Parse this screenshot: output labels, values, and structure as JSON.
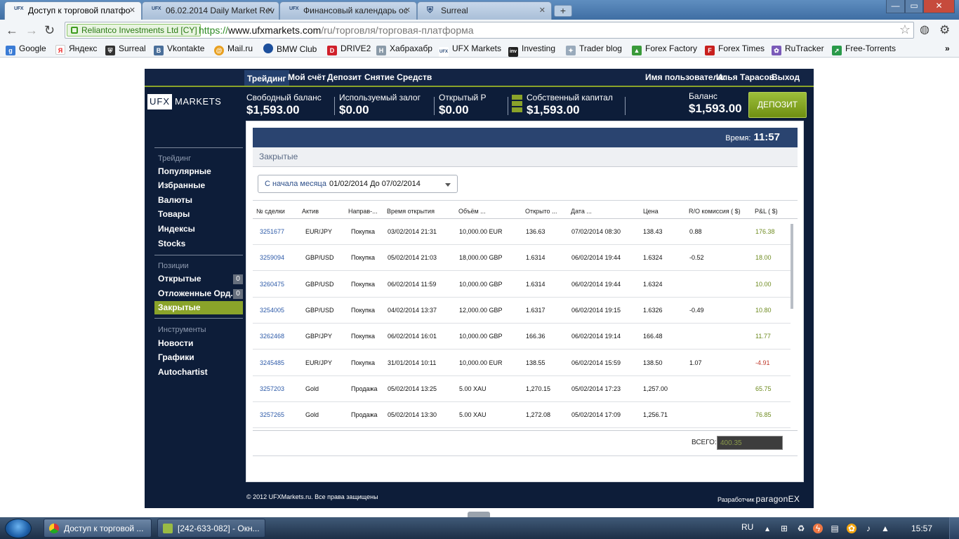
{
  "browser": {
    "tabs": [
      {
        "fav": "UFX",
        "title": "Доступ к торговой платфо"
      },
      {
        "fav": "UFX",
        "title": "06.02.2014 Daily Market Rev"
      },
      {
        "fav": "UFX",
        "title": "Финансовый календарь ос"
      },
      {
        "fav": "shield-icon",
        "title": "Surreal"
      }
    ],
    "new_tab": "+",
    "window_controls": {
      "minimize": "—",
      "maximize": "▭",
      "close": "✕"
    },
    "ev_cert": "Reliantco Investments Ltd [CY]",
    "url": {
      "scheme": "https://",
      "host": "www.ufxmarkets.com",
      "path": "/ru/торговля/торговая-платформа"
    },
    "bookmarks": [
      "Google",
      "Яндекс",
      "Surreal",
      "Vkontakte",
      "Mail.ru",
      "BMW Club",
      "DRIVE2",
      "Хабрахабр",
      "UFX Markets",
      "Investing",
      "Trader blog",
      "Forex Factory",
      "Forex Times",
      "RuTracker",
      "Free-Torrents"
    ],
    "bookmarks_more": "»"
  },
  "site": {
    "nav": {
      "trading": "Трейдинг",
      "account": "Мой счёт",
      "deposit": "Депозит",
      "withdraw": "Снятие Средств"
    },
    "user": {
      "label": "Имя пользователя:",
      "name": "Илья Тарасов",
      "logout": "Выход"
    },
    "logo": {
      "box": "UFX",
      "text": "MARKETS"
    },
    "stats": {
      "free_balance": {
        "label": "Свободный баланс",
        "value": "$1,593.00"
      },
      "used_margin": {
        "label": "Используемый залог",
        "value": "$0.00"
      },
      "open_pl": {
        "label": "Открытый P",
        "value": "$0.00"
      },
      "equity": {
        "label": "Собственный капитал",
        "value": "$1,593.00"
      },
      "balance": {
        "label": "Баланс",
        "value": "$1,593.00"
      }
    },
    "deposit_button": "ДЕПОЗИТ",
    "sidebar": {
      "trading_header": "Трейдинг",
      "trading_items": [
        "Популярные",
        "Избранные",
        "Валюты",
        "Товары",
        "Индексы",
        "Stocks"
      ],
      "positions_header": "Позиции",
      "open": "Открытые",
      "open_count": "0",
      "pending": "Отложенные Орд...",
      "pending_count": "0",
      "closed": "Закрытые",
      "tools_header": "Инструменты",
      "tools_items": [
        "Новости",
        "Графики",
        "Autochartist"
      ]
    },
    "panel": {
      "time_label": "Время:",
      "time_value": "11:57",
      "section": "Закрытые",
      "range_label": "С начала месяца",
      "range_value": "01/02/2014 До 07/02/2014",
      "columns": [
        "№ сделки",
        "Актив",
        "Направ-...",
        "Время открытия",
        "Объём ...",
        "Открыто ...",
        "Дата ...",
        "Цена",
        "R/O комиссия ( $)",
        "P&L ( $)"
      ],
      "rows": [
        [
          "3251677",
          "EUR/JPY",
          "Покупка",
          "03/02/2014 21:31",
          "10,000.00 EUR",
          "136.63",
          "07/02/2014 08:30",
          "138.43",
          "0.88",
          "176.38"
        ],
        [
          "3259094",
          "GBP/USD",
          "Покупка",
          "05/02/2014 21:03",
          "18,000.00 GBP",
          "1.6314",
          "06/02/2014 19:44",
          "1.6324",
          "-0.52",
          "18.00"
        ],
        [
          "3260475",
          "GBP/USD",
          "Покупка",
          "06/02/2014 11:59",
          "10,000.00 GBP",
          "1.6314",
          "06/02/2014 19:44",
          "1.6324",
          "",
          "10.00"
        ],
        [
          "3254005",
          "GBP/USD",
          "Покупка",
          "04/02/2014 13:37",
          "12,000.00 GBP",
          "1.6317",
          "06/02/2014 19:15",
          "1.6326",
          "-0.49",
          "10.80"
        ],
        [
          "3262468",
          "GBP/JPY",
          "Покупка",
          "06/02/2014 16:01",
          "10,000.00 GBP",
          "166.36",
          "06/02/2014 19:14",
          "166.48",
          "",
          "11.77"
        ],
        [
          "3245485",
          "EUR/JPY",
          "Покупка",
          "31/01/2014 10:11",
          "10,000.00 EUR",
          "138.55",
          "06/02/2014 15:59",
          "138.50",
          "1.07",
          "-4.91"
        ],
        [
          "3257203",
          "Gold",
          "Продажа",
          "05/02/2014 13:25",
          "5.00 XAU",
          "1,270.15",
          "05/02/2014 17:23",
          "1,257.00",
          "",
          "65.75"
        ],
        [
          "3257265",
          "Gold",
          "Продажа",
          "05/02/2014 13:30",
          "5.00 XAU",
          "1,272.08",
          "05/02/2014 17:09",
          "1,256.71",
          "",
          "76.85"
        ]
      ],
      "total_label": "ВСЕГО:",
      "total_value": "400.35"
    },
    "footer": {
      "copyright": "© 2012 UFXMarkets.ru. Все права защищены",
      "dev_label": "Разработчик",
      "dev_name": "paragonEX"
    }
  },
  "taskbar": {
    "items": [
      "Доступ к торговой ...",
      "[242-633-082] - Окн..."
    ],
    "lang": "RU",
    "clock": "15:57"
  },
  "colors": {
    "site_bg": "#0d1d39",
    "accent_green": "#8aa32a",
    "header_blue": "#2a4470",
    "pl_positive": "#6d8a1e",
    "pl_negative": "#c0392b"
  }
}
